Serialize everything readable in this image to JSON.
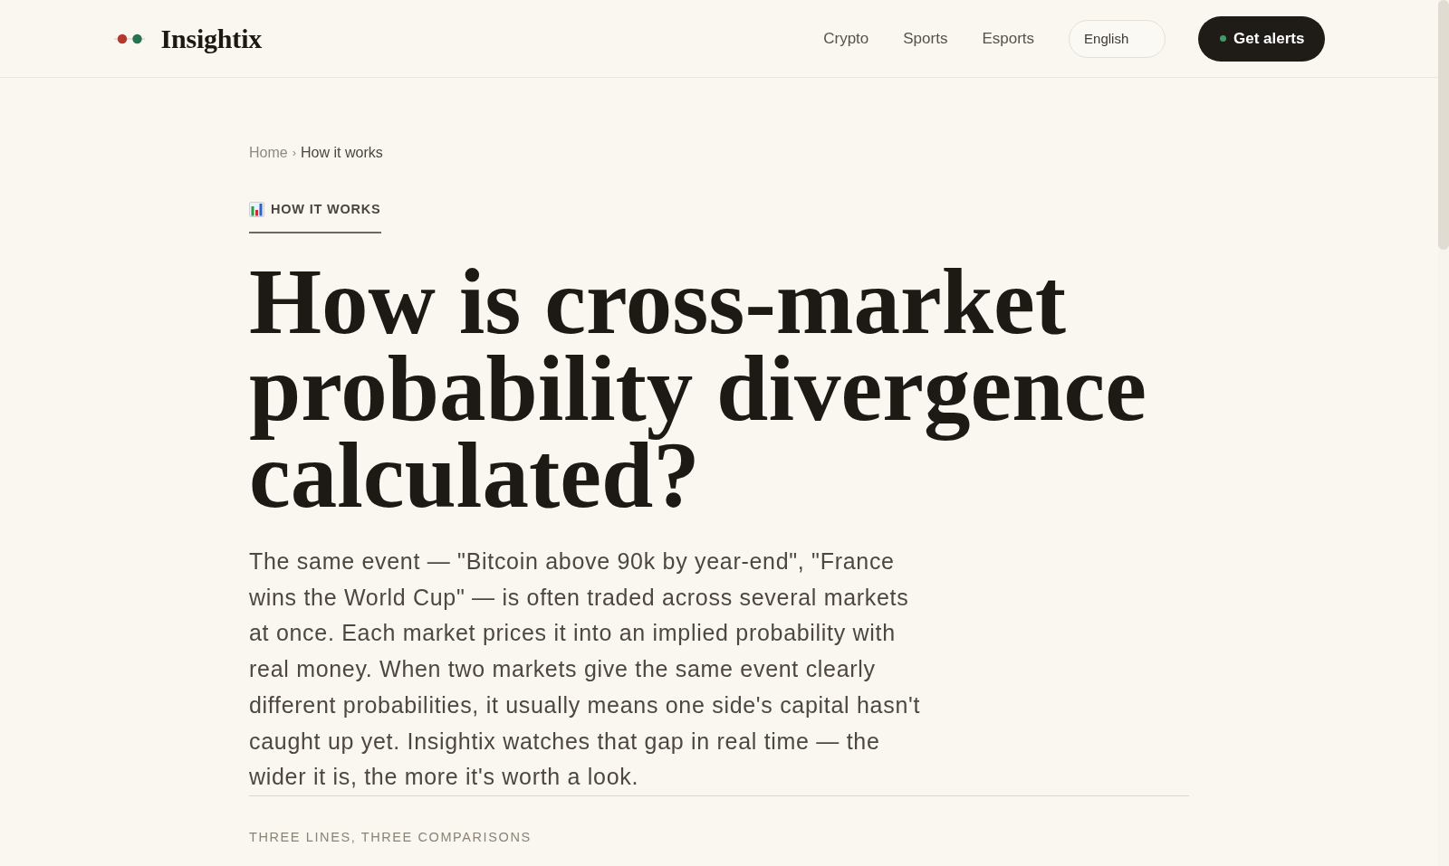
{
  "header": {
    "logo": {
      "text": "Insightix"
    },
    "nav": [
      {
        "label": "Crypto"
      },
      {
        "label": "Sports"
      },
      {
        "label": "Esports"
      }
    ],
    "language_select": {
      "value": "English"
    },
    "cta_button": {
      "label": "Get alerts"
    }
  },
  "breadcrumb": {
    "items": [
      {
        "label": "Home",
        "current": false
      },
      {
        "label": "How it works",
        "current": true
      }
    ],
    "separator": "›"
  },
  "eyebrow": {
    "label": "HOW IT WORKS"
  },
  "title": "How is cross-market probability divergence calculated?",
  "intro": "The same event — \"Bitcoin above 90k by year-end\", \"France wins the World Cup\" — is often traded across several markets at once. Each market prices it into an implied probability with real money. When two markets give the same event clearly different probabilities, it usually means one side's capital hasn't caught up yet. Insightix watches that gap in real time — the wider it is, the more it's worth a look.",
  "section_label": "THREE LINES, THREE COMPARISONS"
}
